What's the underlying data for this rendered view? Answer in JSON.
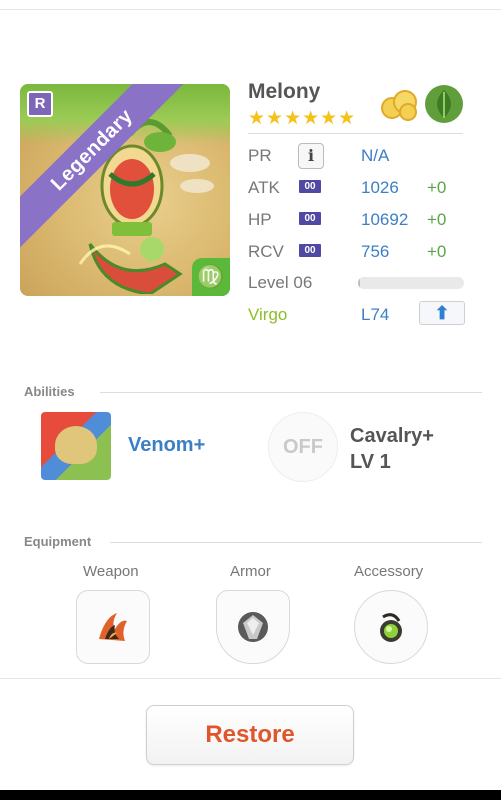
{
  "monster": {
    "name": "Melony",
    "stars": "★★★★★★",
    "rarity_label": "Legendary",
    "rarity_badge": "R",
    "zodiac_glyph": "♍",
    "element_icons": [
      "cloud-element-icon",
      "leaf-element-icon"
    ]
  },
  "stats": {
    "pr": {
      "label": "PR",
      "info": "i",
      "value": "N/A"
    },
    "atk": {
      "label": "ATK",
      "chip": "00",
      "value": "1026",
      "bonus": "+0"
    },
    "hp": {
      "label": "HP",
      "chip": "00",
      "value": "10692",
      "bonus": "+0"
    },
    "rcv": {
      "label": "RCV",
      "chip": "00",
      "value": "756",
      "bonus": "+0"
    },
    "level": {
      "label": "Level 06",
      "progress": 0.02
    },
    "sign": {
      "label": "Virgo",
      "value": "L74",
      "button_icon": "up-arrow-icon"
    }
  },
  "abilities": {
    "heading": "Abilities",
    "items": [
      {
        "name": "Venom+",
        "icon": "skull-ability-icon"
      },
      {
        "state": "OFF",
        "name": "Cavalry+",
        "level": "LV 1"
      }
    ]
  },
  "equipment": {
    "heading": "Equipment",
    "slots": [
      {
        "label": "Weapon",
        "icon": "flame-claw-icon"
      },
      {
        "label": "Armor",
        "icon": "gem-icon"
      },
      {
        "label": "Accessory",
        "icon": "green-orb-icon"
      }
    ]
  },
  "footer": {
    "restore_label": "Restore"
  },
  "colors": {
    "accent_blue": "#3d7fc4",
    "bonus_green": "#5aa54a",
    "restore_orange": "#e0562c",
    "legendary_purple": "#8a72c7",
    "star_gold": "#f4c21b"
  }
}
